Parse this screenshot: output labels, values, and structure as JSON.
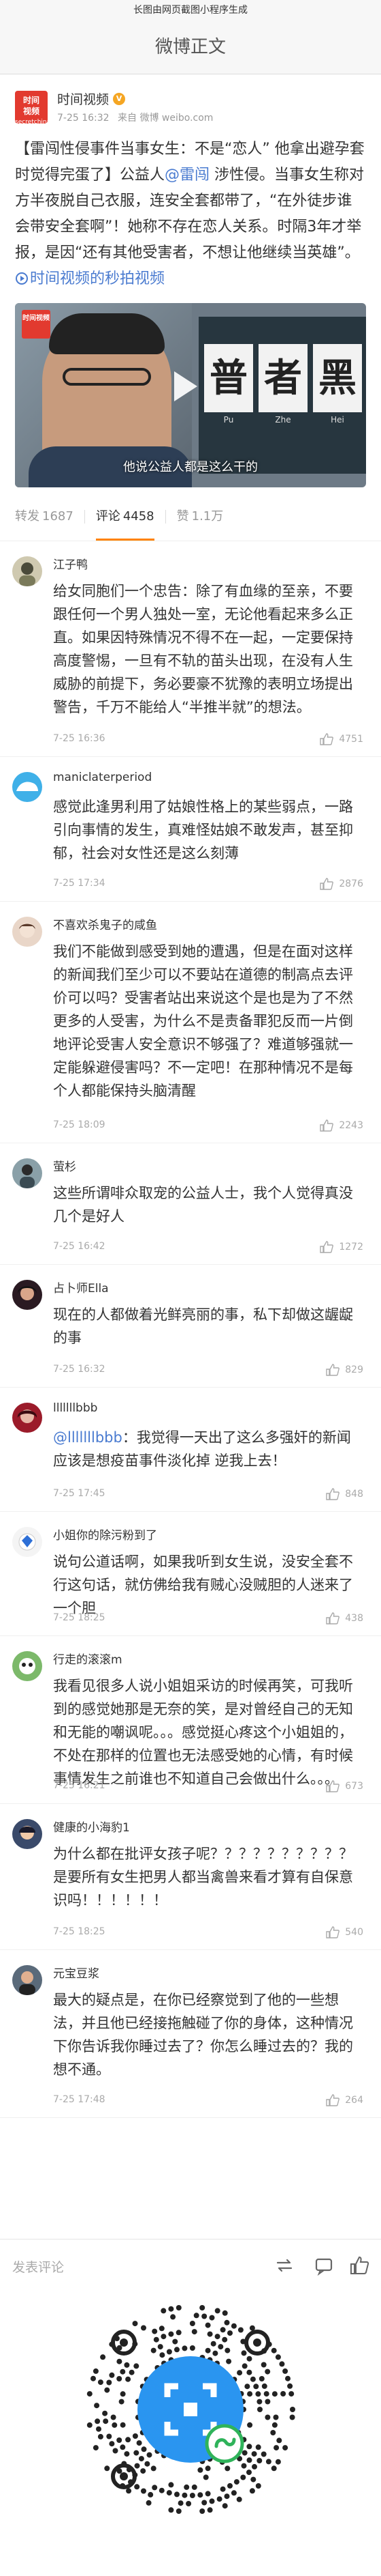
{
  "top_banner": "长图由网页截图小程序生成",
  "nav_title": "微博正文",
  "post": {
    "logo_lines": [
      "时间",
      "视频"
    ],
    "logo_sub": "secretchina",
    "author": "时间视频",
    "time": "7-25 16:32",
    "source": "来自 微博 weibo.com",
    "text_before": "【雷闯性侵事件当事女生：不是“恋人” 他拿出避孕套时觉得完蛋了】公益人",
    "mention": "@雷闯",
    "text_middle": " 涉性侵。当事女生称对方半夜脱自己衣服，连安全套都带了，“在外徒步谁会带安全套啊”！她称不存在恋人关系。时隔3年才举报，是因“还有其他受害者，不想让他继续当英雄”。",
    "link_text": "时间视频的秒拍视频",
    "video_caption": "他说公益人都是这么干的",
    "video_logo": "时间视频",
    "sign_chars": [
      "普",
      "者",
      "黑"
    ],
    "sign_subs": [
      "Pu",
      "Zhe",
      "Hei"
    ]
  },
  "tabs": {
    "repost_label": "转发",
    "repost_count": "1687",
    "comment_label": "评论",
    "comment_count": "4458",
    "like_label": "赞",
    "like_count": "1.1万"
  },
  "comments": [
    {
      "name": "江子鸭",
      "text": "给女同胞们一个忠告：除了有血缘的至亲，不要跟任何一个男人独处一室，无论他看起来多么正直。如果因特殊情况不得不在一起，一定要保持高度警惕，一旦有不轨的苗头出现，在没有人生威胁的前提下，务必要豪不犹豫的表明立场提出警告，千万不能给人“半推半就”的想法。",
      "time": "7-25 16:36",
      "likes": "4751"
    },
    {
      "name": "maniclaterperiod",
      "text": "感觉此逢男利用了姑娘性格上的某些弱点，一路引向事情的发生，真难怪姑娘不敢发声，甚至抑郁，社会对女性还是这么刻薄",
      "time": "7-25 17:34",
      "likes": "2876"
    },
    {
      "name": "不喜欢杀鬼子的咸鱼",
      "text": "我们不能做到感受到她的遭遇，但是在面对这样的新闻我们至少可以不要站在道德的制高点去评价可以吗？受害者站出来说这个是也是为了不然更多的人受害，为什么不是责备罪犯反而一片倒地评论受害人安全意识不够强了？难道够强就一定能躲避侵害吗？不一定吧！在那种情况不是每个人都能保持头脑清醒",
      "time": "7-25 18:09",
      "likes": "2243"
    },
    {
      "name": "萤杉",
      "text": "这些所谓啡众取宠的公益人士，我个人觉得真没几个是好人",
      "time": "7-25 16:42",
      "likes": "1272"
    },
    {
      "name": "占卜师Ella",
      "text": "现在的人都做着光鲜亮丽的事，私下却做这龌龊的事",
      "time": "7-25 16:32",
      "likes": "829"
    },
    {
      "name": "lllllllbbb",
      "mention": "@lllllllbbb",
      "text": "：我觉得一天出了这么多强奸的新闻 应该是想疫苗事件淡化掉 逆我上去！",
      "time": "7-25 17:45",
      "likes": "848"
    },
    {
      "name": "小姐你的除污粉到了",
      "text": "说句公道话啊，如果我听到女生说，没安全套不行这句话，就仿佛给我有贼心没贼胆的人迷来了一个胆",
      "time": "7-25 18:25",
      "likes": "438"
    },
    {
      "name": "行走的滚滚m",
      "text": "我看见很多人说小姐姐采访的时候再笑，可我听到的感觉她那是无奈的笑，是对曾经自己的无知和无能的嘲讽呢。。。感觉挺心疼这个小姐姐的，不处在那样的位置也无法感受她的心情，有时候事情发生之前谁也不知道自己会做出什么。。。",
      "time": "7-25 16:21",
      "likes": "673"
    },
    {
      "name": "健康的小海豹1",
      "text": "为什么都在批评女孩子呢？？？？？？？？？？是要所有女生把男人都当禽兽来看才算有自保意识吗！！！！！！",
      "time": "7-25 18:25",
      "likes": "540"
    },
    {
      "name": "元宝豆浆",
      "text": "最大的疑点是，在你已经察觉到了他的一些想法，并且他已经接拖触碰了你的身体，这种情况下你告诉我你睡过去了？你怎么睡过去的？我的想不通。",
      "time": "7-25 17:48",
      "likes": "264"
    }
  ],
  "footer": {
    "placeholder": "发表评论"
  }
}
